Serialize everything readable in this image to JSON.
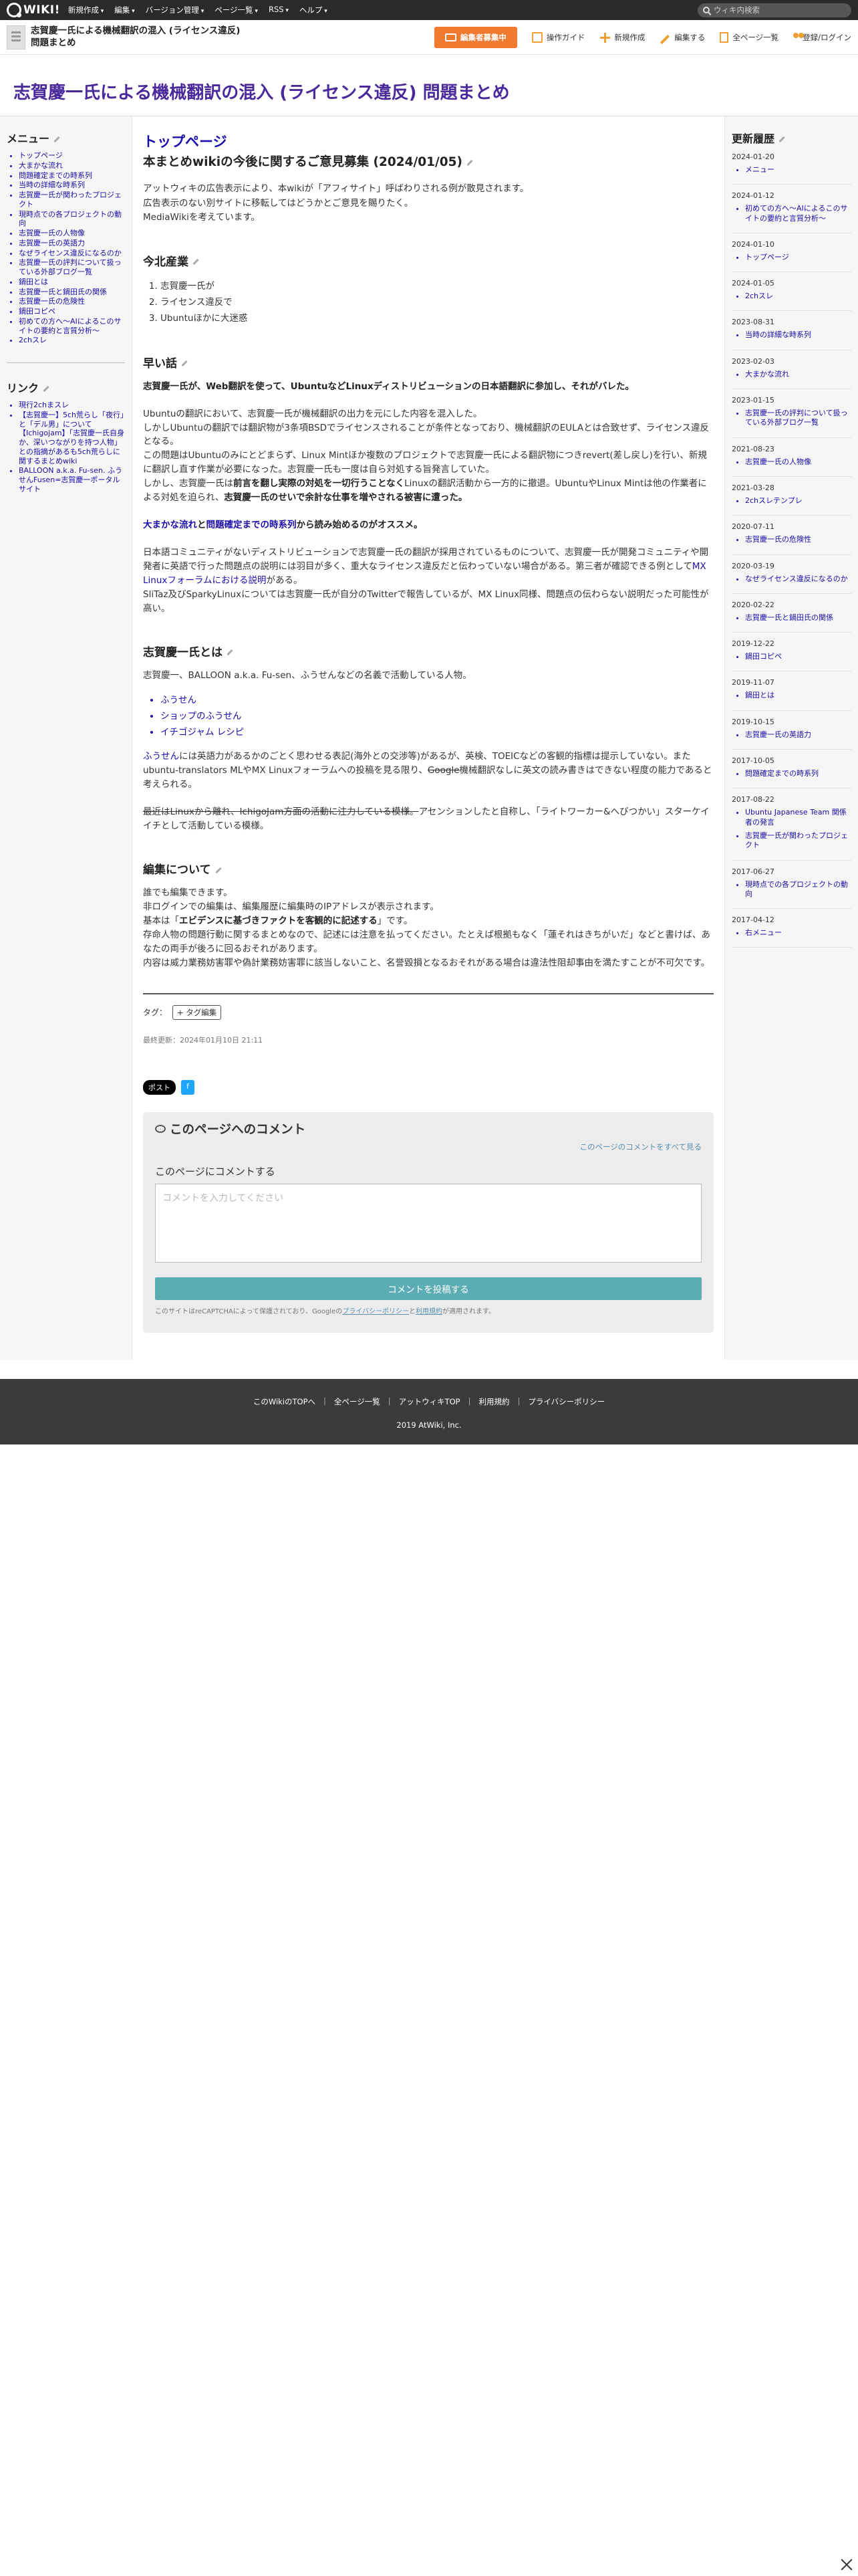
{
  "topbar": {
    "logo": "WIKI!",
    "menu": [
      "新規作成",
      "編集",
      "バージョン管理",
      "ページ一覧",
      "RSS",
      "ヘルプ"
    ],
    "search_placeholder": "ウィキ内検索"
  },
  "header": {
    "site_title": "志賀慶一氏による機械翻訳の混入 (ライセンス違反) 問題まとめ",
    "recruit": "編集者募集中",
    "guide": "操作ガイド",
    "new": "新規作成",
    "edit": "編集する",
    "allpages": "全ページ一覧",
    "login": "登録/ログイン"
  },
  "page_title": "志賀慶一氏による機械翻訳の混入 (ライセンス違反) 問題まとめ",
  "left": {
    "menu_heading": "メニュー",
    "menu_items": [
      "トップページ",
      "大まかな流れ",
      "問題確定までの時系列",
      "当時の詳細な時系列",
      "志賀慶一氏が関わったプロジェクト",
      "現時点での各プロジェクトの動向",
      "志賀慶一氏の人物像",
      "志賀慶一氏の英語力",
      "なぜライセンス違反になるのか",
      "志賀慶一氏の評判について扱っている外部ブログ一覧",
      "鍋田とは",
      "志賀慶一氏と鍋田氏の関係",
      "志賀慶一氏の危険性",
      "鍋田コピペ",
      "初めての方へ〜AIによるこのサイトの要約と言質分析〜",
      "2chスレ"
    ],
    "link_heading": "リンク",
    "link_items": [
      "現行2chまスレ",
      "【志賀慶一】5ch荒らし「夜行」と「デル男」について【Ichigojam】「志賀慶一氏自身か、深いつながりを持つ人物」との指摘があるも5ch荒らしに関するまとめwiki",
      "BALLOON a.k.a. Fu-sen. ふうせんFusen=志賀慶一ポータルサイト"
    ]
  },
  "right": {
    "heading": "更新履歴",
    "entries": [
      {
        "date": "2024-01-20",
        "items": [
          "メニュー"
        ]
      },
      {
        "date": "2024-01-12",
        "items": [
          "初めての方へ〜AIによるこのサイトの要約と言質分析〜"
        ]
      },
      {
        "date": "2024-01-10",
        "items": [
          "トップページ"
        ]
      },
      {
        "date": "2024-01-05",
        "items": [
          "2chスレ"
        ]
      },
      {
        "date": "2023-08-31",
        "items": [
          "当時の詳細な時系列"
        ]
      },
      {
        "date": "2023-02-03",
        "items": [
          "大まかな流れ"
        ]
      },
      {
        "date": "2023-01-15",
        "items": [
          "志賀慶一氏の評判について扱っている外部ブログ一覧"
        ]
      },
      {
        "date": "2021-08-23",
        "items": [
          "志賀慶一氏の人物像"
        ]
      },
      {
        "date": "2021-03-28",
        "items": [
          "2chスレテンプレ"
        ]
      },
      {
        "date": "2020-07-11",
        "items": [
          "志賀慶一氏の危険性"
        ]
      },
      {
        "date": "2020-03-19",
        "items": [
          "なぜライセンス違反になるのか"
        ]
      },
      {
        "date": "2020-02-22",
        "items": [
          "志賀慶一氏と鍋田氏の関係"
        ]
      },
      {
        "date": "2019-12-22",
        "items": [
          "鍋田コピペ"
        ]
      },
      {
        "date": "2019-11-07",
        "items": [
          "鍋田とは"
        ]
      },
      {
        "date": "2019-10-15",
        "items": [
          "志賀慶一氏の英語力"
        ]
      },
      {
        "date": "2017-10-05",
        "items": [
          "問題確定までの時系列"
        ]
      },
      {
        "date": "2017-08-22",
        "items": [
          "Ubuntu Japanese Team 関係者の発言",
          "志賀慶一氏が関わったプロジェクト"
        ]
      },
      {
        "date": "2017-06-27",
        "items": [
          "現時点での各プロジェクトの動向"
        ]
      },
      {
        "date": "2017-04-12",
        "items": [
          "右メニュー"
        ]
      }
    ]
  },
  "main": {
    "toppage": "トップページ",
    "notice_heading": "本まとめwikiの今後に関するご意見募集 (2024/01/05)",
    "notice_p1": "アットウィキの広告表示により、本wikiが「アフィサイト」呼ばわりされる例が散見されます。",
    "notice_p2": "広告表示のない別サイトに移転してはどうかとご意見を賜りたく。",
    "notice_p3": "MediaWikiを考えています。",
    "h_wafu": "今北産業",
    "wafu": [
      "志賀慶一氏が",
      "ライセンス違反で",
      "Ubuntuほかに大迷惑"
    ],
    "h_hayai": "早い話",
    "hayai_bold": "志賀慶一氏が、Web翻訳を使って、UbuntuなどLinuxディストリビューションの日本語翻訳に参加し、それがバレた。",
    "p1": "Ubuntuの翻訳において、志賀慶一氏が機械翻訳の出力を元にした内容を混入した。",
    "p2": "しかしUbuntuの翻訳では翻訳物が3条項BSDでライセンスされることが条件となっており、機械翻訳のEULAとは合致せず、ライセンス違反となる。",
    "p3": "この問題はUbuntuのみにとどまらず、Linux Mintほか複数のプロジェクトで志賀慶一氏による翻訳物につきrevert(差し戻し)を行い、新規に翻訳し直す作業が必要になった。志賀慶一氏も一度は自ら対処する旨発言していた。",
    "p4a": "しかし、志賀慶一氏は",
    "p4b": "前言を翻し実際の対処を一切行うことなく",
    "p4c": "Linuxの翻訳活動から一方的に撤退。UbuntuやLinux Mintは他の作業者による対処を迫られ、",
    "p4d": "志賀慶一氏のせいで余計な仕事を増やされる被害に遭った。",
    "rec_a": "大まかな流れ",
    "rec_b": "と",
    "rec_c": "問題確定までの時系列",
    "rec_d": "から読み始めるのがオススメ。",
    "p5": "日本語コミュニティがないディストリビューションで志賀慶一氏の翻訳が採用されているものについて、志賀慶一氏が開発コミュニティや開発者に英語で行った問題点の説明には羽目が多く、重大なライセンス違反だと伝わっていない場合がある。第三者が確認できる例として",
    "p5link": "MX Linuxフォーラムにおける説明",
    "p5end": "がある。",
    "p6": "SliTaz及びSparkyLinuxについては志賀慶一氏が自分のTwitterで報告しているが、MX Linux同様、問題点の伝わらない説明だった可能性が高い。",
    "h_who": "志賀慶一氏とは",
    "who_p": "志賀慶一、BALLOON a.k.a. Fu-sen、ふうせんなどの名義で活動している人物。",
    "who_list": [
      "ふうせん",
      "ショップのふうせん",
      "イチゴジャム レシピ"
    ],
    "who_p2a": "ふうせん",
    "who_p2b": "には英語力があるかのごとく思わせる表記(海外との交渉等)があるが、英検、TOEICなどの客観的指標は提示していない。また ubuntu-translators MLやMX Linuxフォーラムへの投稿を見る限り、",
    "who_p2c": "Google",
    "who_p2d": "機械翻訳なしに英文の読み書きはできない程度の能力であると考えられる。",
    "who_p3a": "最近はLinuxから離れ、IchigoJam方面の活動に注力している模様。",
    "who_p3b": "アセンションしたと自称し、「ライトワーカー&へびつかい」スターケイイチとして活動している模様。",
    "h_edit": "編集について",
    "edit_p1": "誰でも編集できます。",
    "edit_p2": "非ログインでの編集は、編集履歴に編集時のIPアドレスが表示されます。",
    "edit_p3a": "基本は「",
    "edit_p3b": "エビデンスに基づきファクトを客観的に記述する",
    "edit_p3c": "」です。",
    "edit_p4": "存命人物の問題行動に関するまとめなので、記述には注意を払ってください。たとえば根拠もなく「蓮それはきちがいだ」などと書けば、あなたの両手が後ろに回るおそれがあります。",
    "edit_p5": "内容は威力業務妨害罪や偽計業務妨害罪に該当しないこと、名誉毀損となるおそれがある場合は違法性阻却事由を満たすことが不可欠です。",
    "tag_label": "タグ：",
    "tag_btn": "+ タグ編集",
    "updated": "最終更新：2024年01月10日 21:11",
    "post_btn": "ポスト",
    "fb_btn": "f"
  },
  "comments": {
    "title": "このページへのコメント",
    "view_all": "このページのコメントをすべて見る",
    "label": "このページにコメントする",
    "placeholder": "コメントを入力してください",
    "submit": "コメントを投稿する",
    "note1": "このサイトはreCAPTCHAによって保護されており、Googleの",
    "privacy": "プライバシーポリシー",
    "note2": "と",
    "terms": "利用規約",
    "note3": "が適用されます。"
  },
  "footer": {
    "links": [
      "このWikiのTOPへ",
      "全ページ一覧",
      "アットウィキTOP",
      "利用規約",
      "プライバシーポリシー"
    ],
    "copyright": "2019 AtWiki, Inc."
  }
}
